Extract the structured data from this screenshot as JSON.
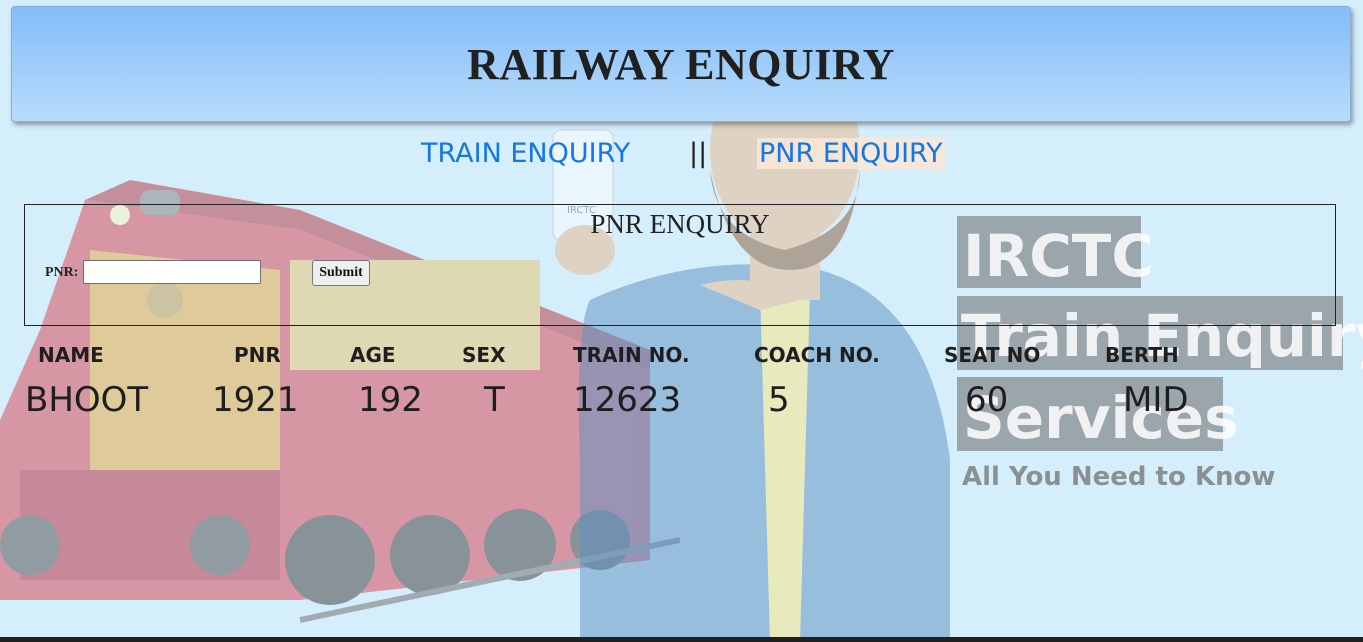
{
  "header": {
    "title": "RAILWAY ENQUIRY"
  },
  "nav": {
    "train_enquiry": "TRAIN ENQUIRY",
    "separator": "||",
    "pnr_enquiry": "PNR ENQUIRY"
  },
  "form": {
    "title": "PNR ENQUIRY",
    "pnr_label": "PNR:",
    "pnr_value": "",
    "submit_label": "Submit"
  },
  "results": {
    "columns": [
      "NAME",
      "PNR",
      "AGE",
      "SEX",
      "TRAIN NO.",
      "COACH NO.",
      "SEAT NO",
      "BERTH"
    ],
    "rows": [
      [
        "BHOOT",
        "1921",
        "192",
        "T",
        "12623",
        "5",
        "60",
        "MID"
      ]
    ]
  },
  "background_banner": {
    "line1": "IRCTC",
    "line2": "Train Enquiry",
    "line3": "Services",
    "tagline": "All You Need to Know",
    "phone_logo": "IRCTC"
  },
  "colors": {
    "page_bg": "#d4eefb",
    "header_bg": "#83bdf7",
    "link": "#1576e6"
  }
}
